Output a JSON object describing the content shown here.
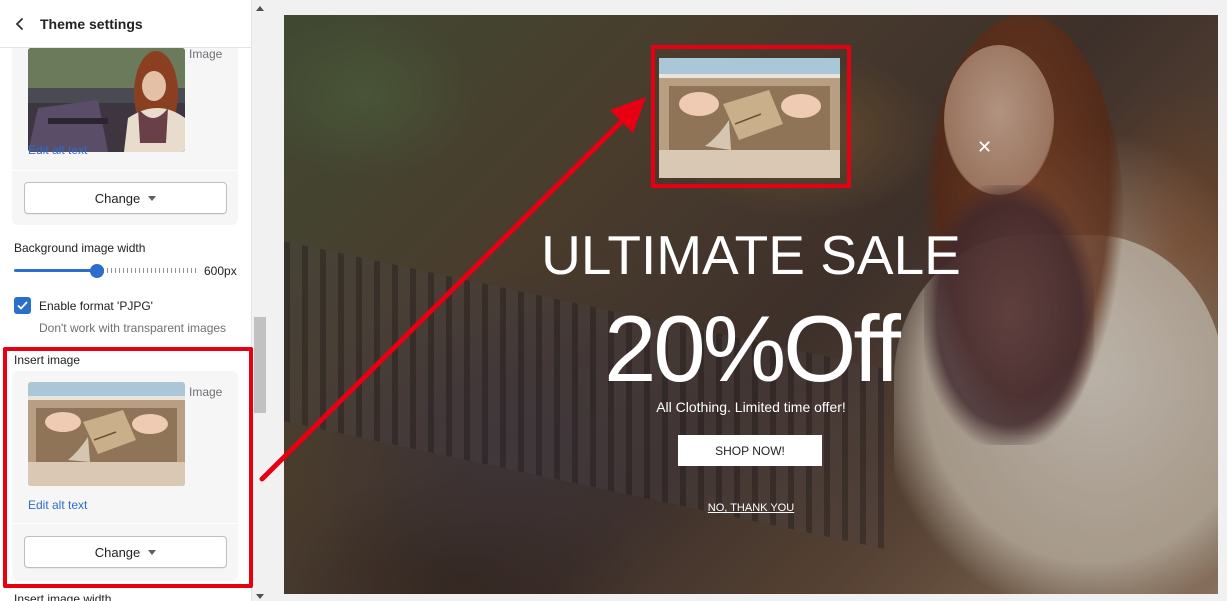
{
  "header": {
    "title": "Theme settings",
    "back_icon": "chevron-left-icon"
  },
  "background_image_card": {
    "image_label": "Image",
    "edit_alt_text": "Edit alt text",
    "change_label": "Change"
  },
  "background_width": {
    "label": "Background image width",
    "value_text": "600px",
    "slider_fraction": 0.45
  },
  "pjpg": {
    "label": "Enable format 'PJPG'",
    "help": "Don't work with transparent images",
    "checked": true
  },
  "insert_image": {
    "label": "Insert image",
    "image_label": "Image",
    "edit_alt_text": "Edit alt text",
    "change_label": "Change"
  },
  "cutoff_label": "Insert image width",
  "popup": {
    "title": "ULTIMATE SALE",
    "discount": "20%Off",
    "subtitle": "All Clothing. Limited time offer!",
    "button": "SHOP NOW!",
    "decline": "NO, THANK YOU",
    "close_icon": "close-icon"
  },
  "colors": {
    "accent": "#2c6ecb",
    "annotation": "#e60012"
  }
}
